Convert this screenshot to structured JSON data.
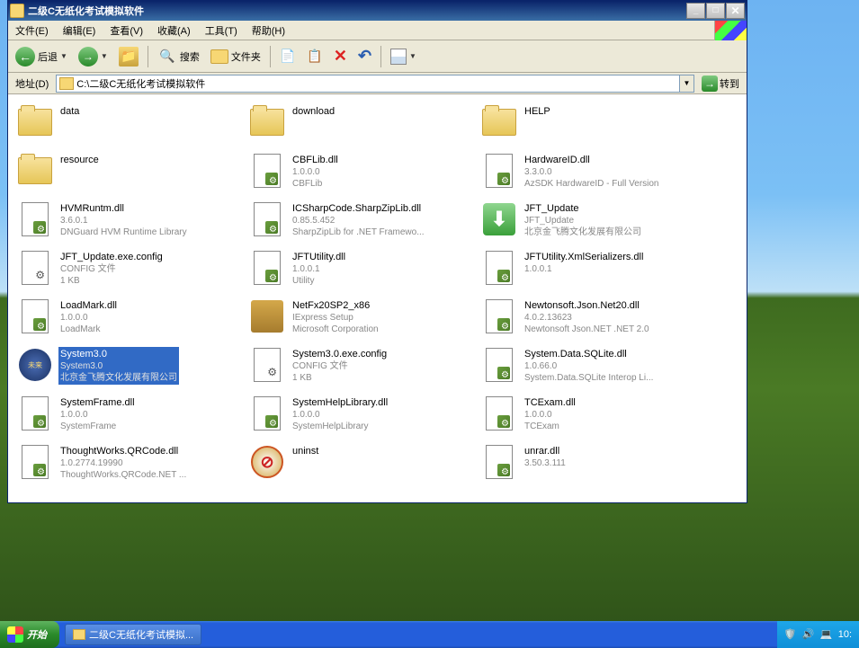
{
  "window": {
    "title": "二级C无纸化考试模拟软件"
  },
  "menu": {
    "file": "文件(E)",
    "edit": "编辑(E)",
    "view": "查看(V)",
    "favorites": "收藏(A)",
    "tools": "工具(T)",
    "help": "帮助(H)"
  },
  "toolbar": {
    "back": "后退",
    "search": "搜索",
    "folders": "文件夹"
  },
  "address": {
    "label": "地址(D)",
    "value": "C:\\二级C无纸化考试模拟软件",
    "go": "转到"
  },
  "files": [
    {
      "type": "folder",
      "name": "data",
      "meta1": "",
      "meta2": ""
    },
    {
      "type": "folder",
      "name": "download",
      "meta1": "",
      "meta2": ""
    },
    {
      "type": "folder",
      "name": "HELP",
      "meta1": "",
      "meta2": ""
    },
    {
      "type": "folder",
      "name": "resource",
      "meta1": "",
      "meta2": ""
    },
    {
      "type": "dll",
      "name": "CBFLib.dll",
      "meta1": "1.0.0.0",
      "meta2": "CBFLib"
    },
    {
      "type": "dll",
      "name": "HardwareID.dll",
      "meta1": "3.3.0.0",
      "meta2": "AzSDK HardwareID - Full Version"
    },
    {
      "type": "dll",
      "name": "HVMRuntm.dll",
      "meta1": "3.6.0.1",
      "meta2": "DNGuard HVM Runtime Library"
    },
    {
      "type": "dll",
      "name": "ICSharpCode.SharpZipLib.dll",
      "meta1": "0.85.5.452",
      "meta2": "SharpZipLib for .NET Framewo..."
    },
    {
      "type": "exe",
      "name": "JFT_Update",
      "meta1": "JFT_Update",
      "meta2": "北京金飞腾文化发展有限公司"
    },
    {
      "type": "config",
      "name": "JFT_Update.exe.config",
      "meta1": "CONFIG 文件",
      "meta2": "1 KB"
    },
    {
      "type": "dll",
      "name": "JFTUtility.dll",
      "meta1": "1.0.0.1",
      "meta2": "Utility"
    },
    {
      "type": "dll",
      "name": "JFTUtility.XmlSerializers.dll",
      "meta1": "1.0.0.1",
      "meta2": ""
    },
    {
      "type": "dll",
      "name": "LoadMark.dll",
      "meta1": "1.0.0.0",
      "meta2": "LoadMark"
    },
    {
      "type": "iexpress",
      "name": "NetFx20SP2_x86",
      "meta1": "IExpress Setup",
      "meta2": "Microsoft Corporation"
    },
    {
      "type": "dll",
      "name": "Newtonsoft.Json.Net20.dll",
      "meta1": "4.0.2.13623",
      "meta2": "Newtonsoft Json.NET .NET 2.0"
    },
    {
      "type": "app",
      "name": "System3.0",
      "meta1": "System3.0",
      "meta2": "北京金飞腾文化发展有限公司",
      "selected": true
    },
    {
      "type": "config",
      "name": "System3.0.exe.config",
      "meta1": "CONFIG 文件",
      "meta2": "1 KB"
    },
    {
      "type": "dll",
      "name": "System.Data.SQLite.dll",
      "meta1": "1.0.66.0",
      "meta2": "System.Data.SQLite Interop Li..."
    },
    {
      "type": "dll",
      "name": "SystemFrame.dll",
      "meta1": "1.0.0.0",
      "meta2": "SystemFrame"
    },
    {
      "type": "dll",
      "name": "SystemHelpLibrary.dll",
      "meta1": "1.0.0.0",
      "meta2": "SystemHelpLibrary"
    },
    {
      "type": "dll",
      "name": "TCExam.dll",
      "meta1": "1.0.0.0",
      "meta2": "TCExam"
    },
    {
      "type": "dll",
      "name": "ThoughtWorks.QRCode.dll",
      "meta1": "1.0.2774.19990",
      "meta2": "ThoughtWorks.QRCode.NET ..."
    },
    {
      "type": "uninst",
      "name": "uninst",
      "meta1": "",
      "meta2": ""
    },
    {
      "type": "dll",
      "name": "unrar.dll",
      "meta1": "3.50.3.111",
      "meta2": ""
    }
  ],
  "taskbar": {
    "start": "开始",
    "task1": "二级C无纸化考试模拟...",
    "time": "10:"
  }
}
